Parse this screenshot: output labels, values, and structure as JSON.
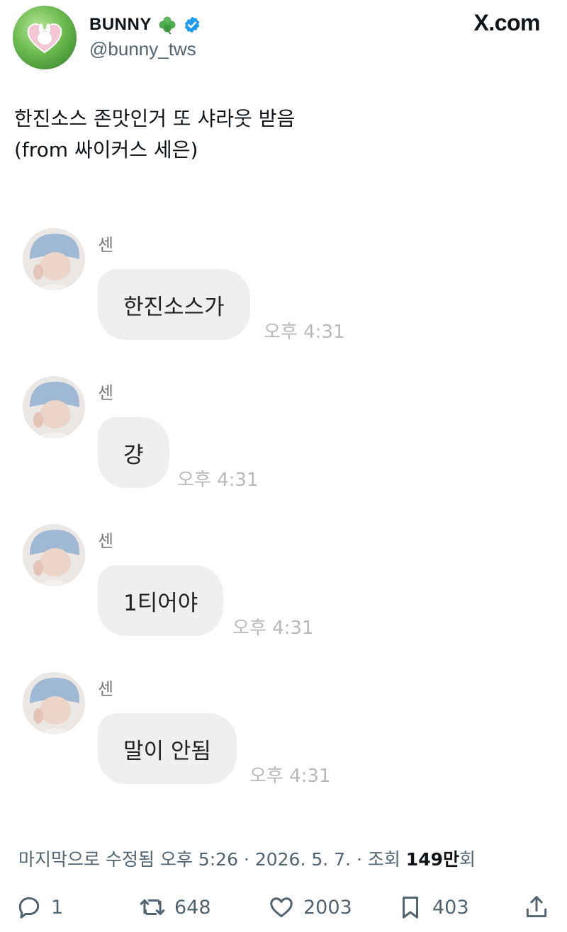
{
  "header": {
    "display_name": "BUNNY",
    "handle": "@bunny_tws",
    "site": "X.com",
    "icons": [
      "clover-icon",
      "verified-badge-icon"
    ]
  },
  "tweet": {
    "line1": "한진소스 존맛인거 또 샤라웃 받음",
    "line2": "(from 싸이커스 세은)"
  },
  "chat": {
    "messages": [
      {
        "sender": "센",
        "text": "한진소스가",
        "time": "오후 4:31"
      },
      {
        "sender": "센",
        "text": "걍",
        "time": "오후 4:31"
      },
      {
        "sender": "센",
        "text": "1티어야",
        "time": "오후 4:31"
      },
      {
        "sender": "센",
        "text": "말이 안됨",
        "time": "오후 4:31"
      }
    ]
  },
  "meta": {
    "edited": "마지막으로 수정됨 오후 5:26",
    "separator": " · ",
    "date": "2026. 5. 7.",
    "views_prefix": " · 조회 ",
    "views_count": "149만",
    "views_suffix": "회"
  },
  "actions": {
    "replies": "1",
    "reposts": "648",
    "likes": "2003",
    "bookmarks": "403"
  },
  "colors": {
    "text": "#0f1419",
    "secondary": "#536471",
    "verified": "#1d9bf0",
    "bubble": "#efefef",
    "timestamp": "#b9b9b9"
  }
}
